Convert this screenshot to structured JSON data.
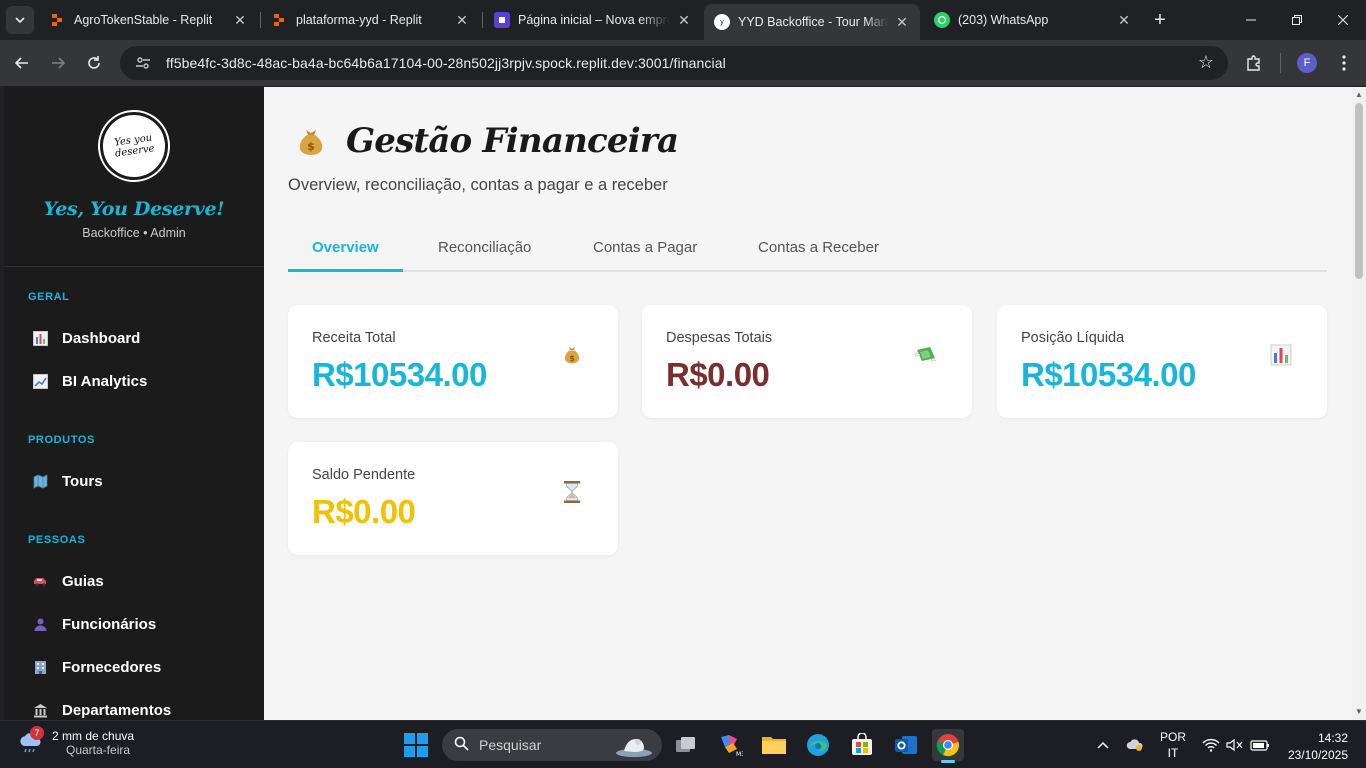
{
  "browser": {
    "tabs": [
      {
        "title": "AgroTokenStable - Replit",
        "favicon": "replit-icon"
      },
      {
        "title": "plataforma-yyd - Replit",
        "favicon": "replit-icon"
      },
      {
        "title": "Página inicial – Nova empresa",
        "favicon": "page-icon"
      },
      {
        "title": "YYD Backoffice - Tour Management",
        "favicon": "yyd-icon",
        "active": true
      },
      {
        "title": "(203) WhatsApp",
        "favicon": "whatsapp-icon"
      }
    ],
    "url": "ff5be4fc-3d8c-48ac-ba4a-bc64b6a17104-00-28n502jj3rpjv.spock.replit.dev:3001/financial",
    "profile_initial": "F"
  },
  "sidebar": {
    "logo_text": "Yes you deserve",
    "brand_name": "Yes, You Deserve!",
    "brand_sub": "Backoffice • Admin",
    "sections": [
      {
        "title": "GERAL",
        "items": [
          {
            "label": "Dashboard",
            "icon": "bar-chart-icon"
          },
          {
            "label": "BI Analytics",
            "icon": "trend-chart-icon"
          }
        ]
      },
      {
        "title": "PRODUTOS",
        "items": [
          {
            "label": "Tours",
            "icon": "map-icon"
          }
        ]
      },
      {
        "title": "PESSOAS",
        "items": [
          {
            "label": "Guias",
            "icon": "car-icon"
          },
          {
            "label": "Funcionários",
            "icon": "person-icon"
          },
          {
            "label": "Fornecedores",
            "icon": "building-icon"
          },
          {
            "label": "Departamentos",
            "icon": "bank-icon"
          }
        ]
      }
    ]
  },
  "main": {
    "title": "Gestão Financeira",
    "subtitle": "Overview, reconciliação, contas a pagar e a receber",
    "tabs": [
      "Overview",
      "Reconciliação",
      "Contas a Pagar",
      "Contas a Receber"
    ],
    "active_tab": "Overview",
    "cards": [
      {
        "label": "Receita Total",
        "value": "R$10534.00",
        "color": "#19b6d9",
        "icon": "money-bag-icon"
      },
      {
        "label": "Despesas Totais",
        "value": "R$0.00",
        "color": "#7a2e2e",
        "icon": "money-wings-icon"
      },
      {
        "label": "Posição Líquida",
        "value": "R$10534.00",
        "color": "#19b6d9",
        "icon": "bar-chart-icon"
      },
      {
        "label": "Saldo Pendente",
        "value": "R$0.00",
        "color": "#f2c200",
        "icon": "hourglass-icon"
      }
    ]
  },
  "taskbar": {
    "weather_badge": "7",
    "weather_line1": "2 mm de chuva",
    "weather_line2": "Quarta-feira",
    "search_placeholder": "Pesquisar",
    "lang_line1": "POR",
    "lang_line2": "IT",
    "time": "14:32",
    "date": "23/10/2025"
  },
  "colors": {
    "accent": "#19b6d9",
    "sidebar_bg": "#1b1b1b",
    "page_bg": "#f5f5f5"
  }
}
